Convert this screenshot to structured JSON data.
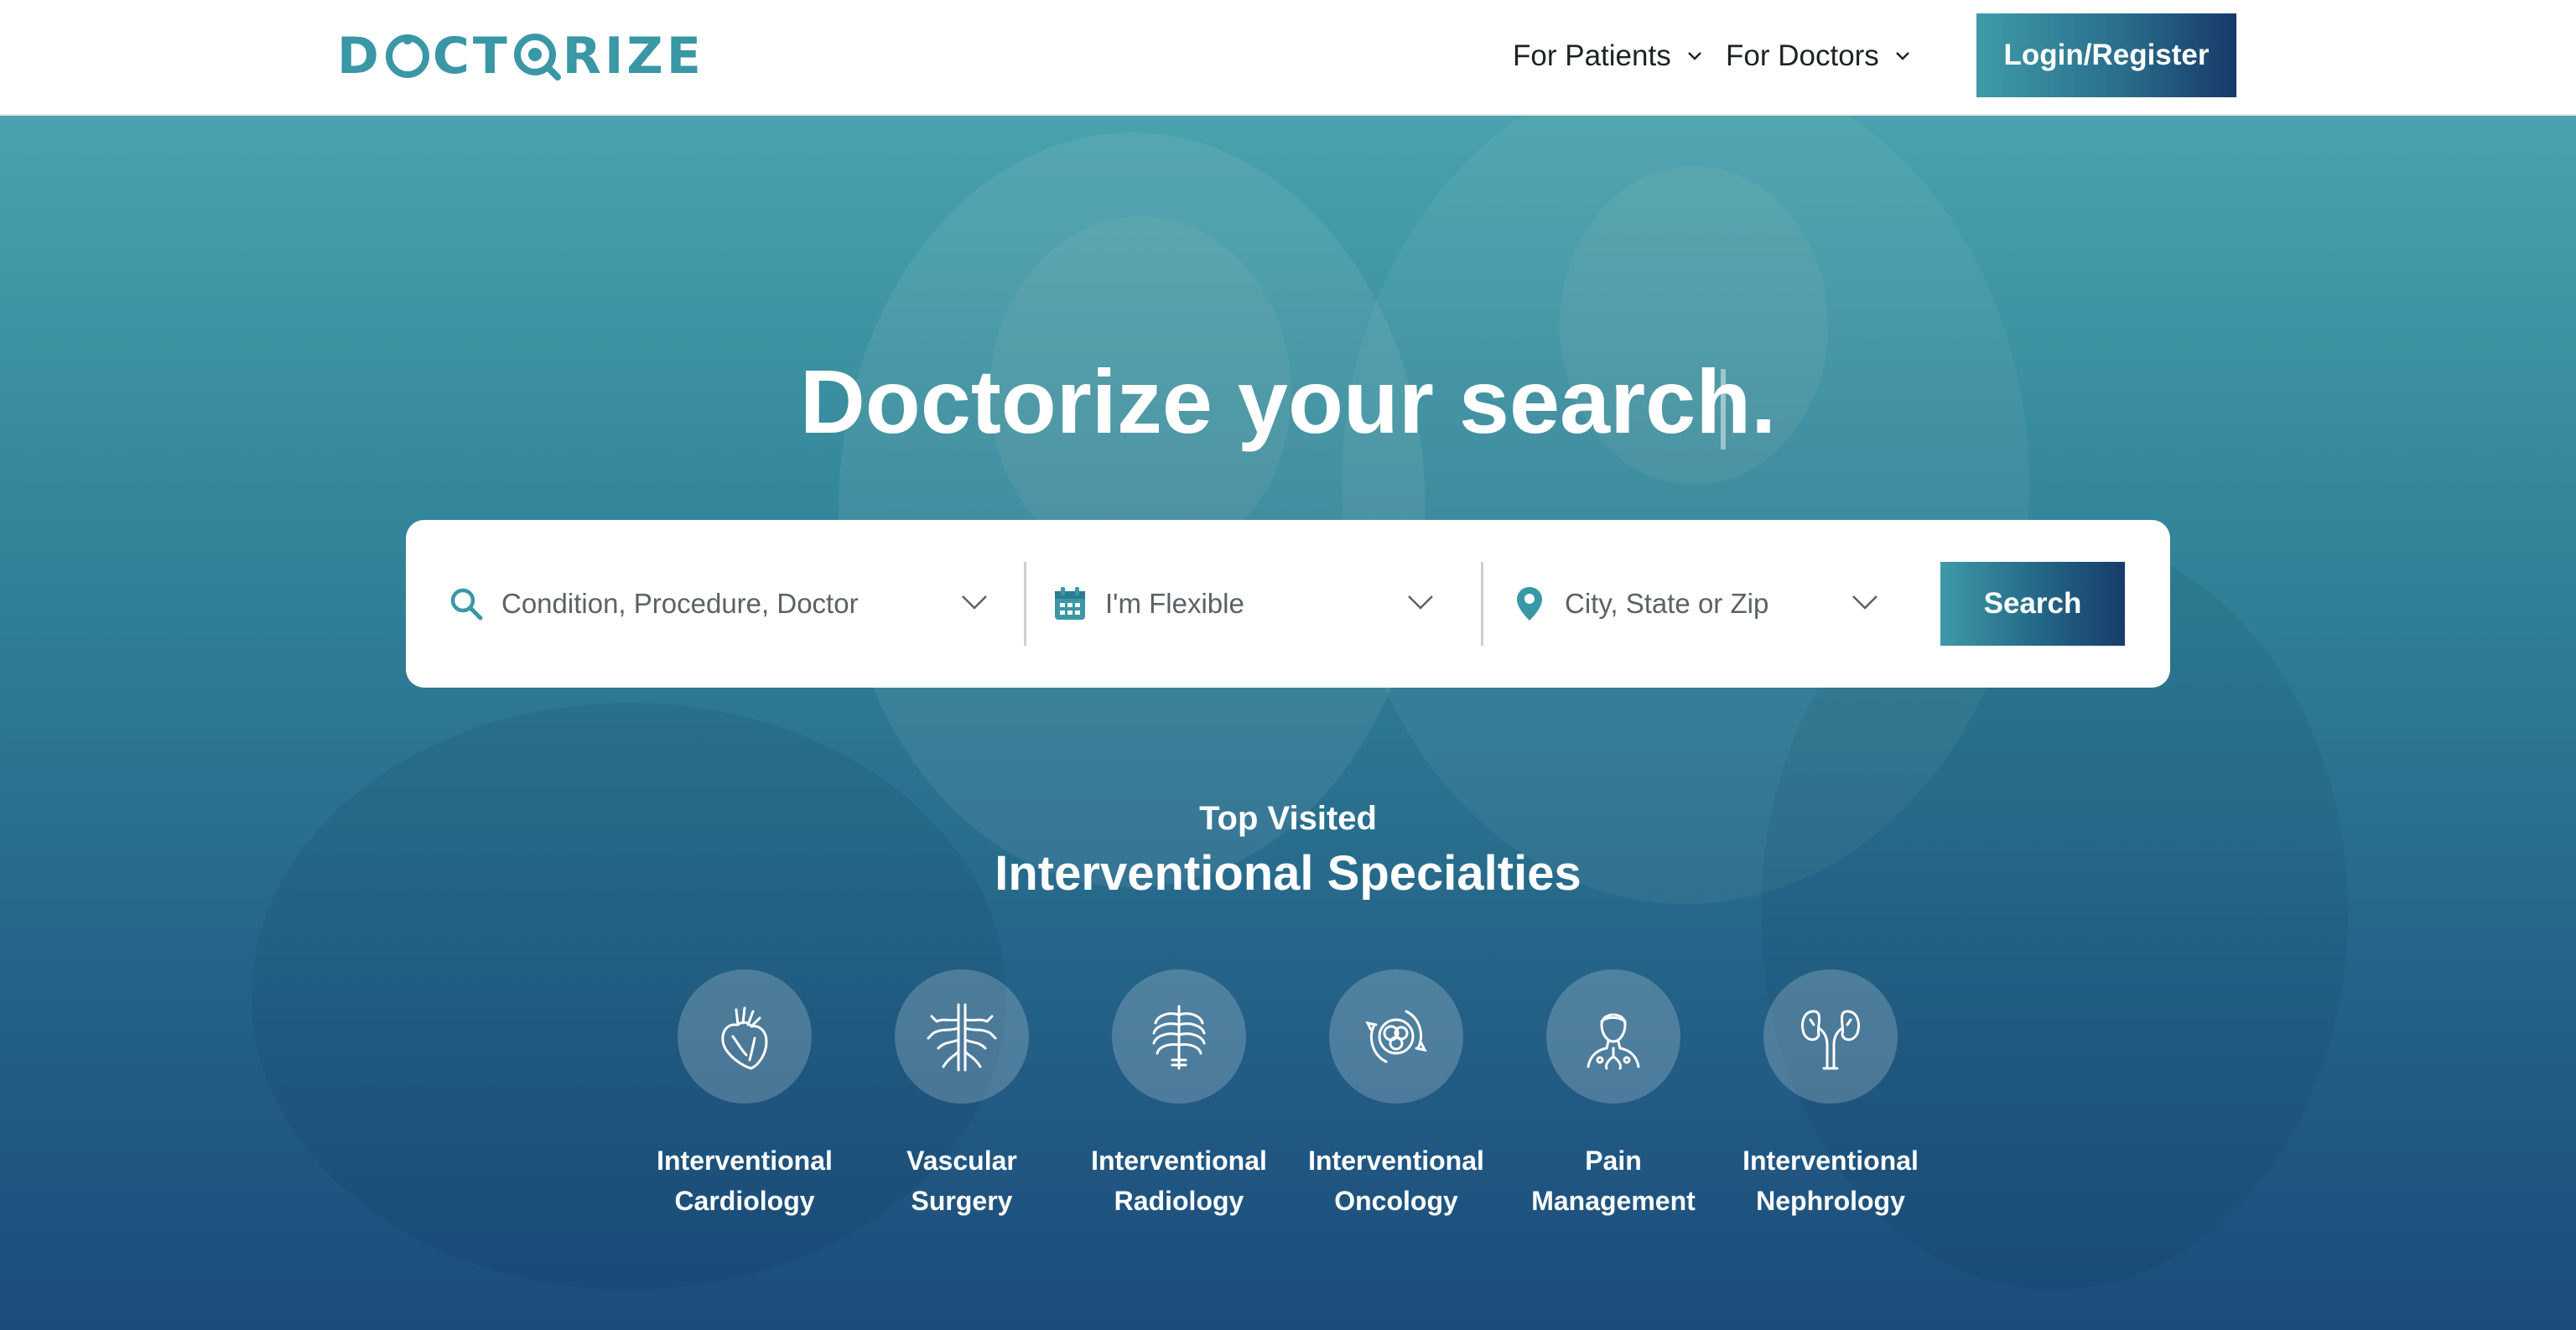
{
  "brand": {
    "logo_parts": [
      "D",
      "CT",
      "RIZE"
    ],
    "accent_color": "#3a97a6",
    "dark_color": "#173a68"
  },
  "header": {
    "nav": [
      {
        "label": "For Patients",
        "icon": "chevron-down-icon"
      },
      {
        "label": "For Doctors",
        "icon": "chevron-down-icon"
      }
    ],
    "login_label": "Login/Register"
  },
  "hero": {
    "title": "Doctorize your search."
  },
  "search": {
    "fields": [
      {
        "placeholder": "Condition, Procedure, Doctor",
        "icon": "search-icon"
      },
      {
        "placeholder": "I'm Flexible",
        "icon": "calendar-icon"
      },
      {
        "placeholder": "City, State or Zip",
        "icon": "location-pin-icon"
      }
    ],
    "button_label": "Search"
  },
  "specialties": {
    "subtitle": "Top Visited",
    "title": "Interventional Specialties",
    "items": [
      {
        "line1": "Interventional",
        "line2": "Cardiology",
        "icon": "heart-icon"
      },
      {
        "line1": "Vascular",
        "line2": "Surgery",
        "icon": "blood-vessels-icon"
      },
      {
        "line1": "Interventional",
        "line2": "Radiology",
        "icon": "ribcage-icon"
      },
      {
        "line1": "Interventional",
        "line2": "Oncology",
        "icon": "cells-icon"
      },
      {
        "line1": "Pain",
        "line2": "Management",
        "icon": "person-nerves-icon"
      },
      {
        "line1": "Interventional",
        "line2": "Nephrology",
        "icon": "kidneys-icon"
      }
    ]
  }
}
